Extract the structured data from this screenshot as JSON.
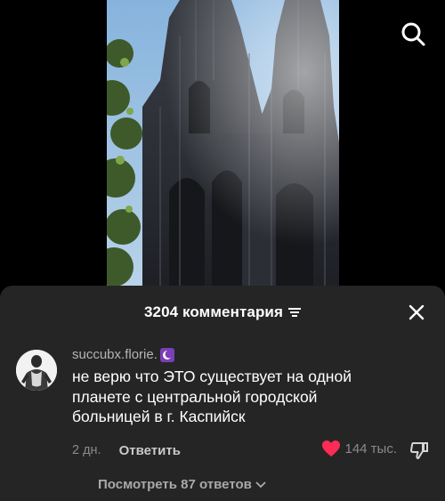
{
  "video": {
    "photo_description_icon": "cathedral-photo"
  },
  "header": {
    "search_icon": "search-icon"
  },
  "comments_sheet": {
    "title": "3204 комментария",
    "filter_icon": "filter-icon",
    "close_icon": "close-icon"
  },
  "comment": {
    "username": "succubx.florie.",
    "badge_icon": "moon-icon",
    "text_lines": [
      "не верю что ЭТО существует на одной",
      "планете с центральной городской",
      "больницей в г. Каспийск"
    ],
    "time": "2 дн.",
    "reply_label": "Ответить",
    "likes": "144 тыс.",
    "like_color": "#fe2c55"
  },
  "view_replies": {
    "label": "Посмотреть 87 ответов"
  },
  "colors": {
    "sheet_bg": "#252526",
    "accent_like": "#fe2c55",
    "badge": "#7b3fb6"
  }
}
